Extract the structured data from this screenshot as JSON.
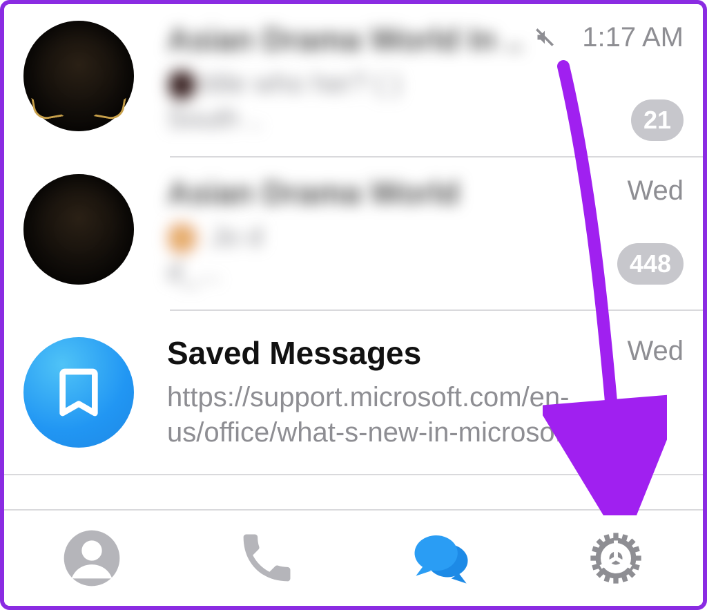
{
  "chats": [
    {
      "title": "Asian Drama World In ..",
      "preview_line1": "title  who  her?  (        )",
      "preview_line2": "            South                     ..",
      "muted": true,
      "time": "1:17 AM",
      "unread": "21"
    },
    {
      "title": "Asian Drama   World",
      "preview_line1": "      Jo                           d",
      "preview_line2": "                                   d_...",
      "muted": false,
      "time": "Wed",
      "unread": "448"
    },
    {
      "title": "Saved Messages",
      "preview": "https://support.microsoft.com/en-us/office/what-s-new-in-microso...",
      "muted": false,
      "time": "Wed",
      "unread": null
    }
  ],
  "tabs": {
    "contacts": "Contacts",
    "calls": "Calls",
    "chats": "Chats",
    "settings": "Settings"
  },
  "colors": {
    "accent": "#2a9df4",
    "annotation": "#a020f0",
    "muted_badge": "#c7c7cc",
    "secondary_text": "#8e8e93"
  }
}
